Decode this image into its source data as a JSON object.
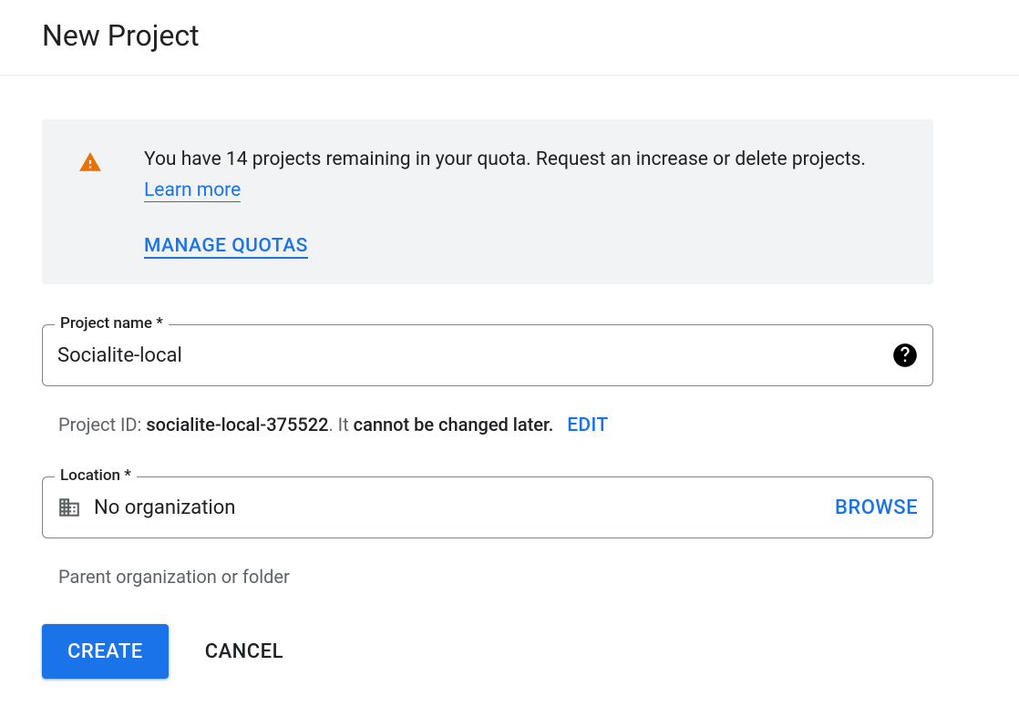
{
  "header": {
    "title": "New Project"
  },
  "quota_notice": {
    "message": "You have 14 projects remaining in your quota. Request an increase or delete projects. ",
    "learn_more_label": "Learn more",
    "manage_quotas_label": "MANAGE QUOTAS"
  },
  "form": {
    "project_name": {
      "label": "Project name *",
      "value": "Socialite-local"
    },
    "project_id": {
      "prefix": "Project ID: ",
      "id": "socialite-local-375522",
      "mid": ". It ",
      "emphasis": "cannot be changed later.",
      "edit_label": "EDIT"
    },
    "location": {
      "label": "Location *",
      "value": "No organization",
      "browse_label": "BROWSE",
      "helper": "Parent organization or folder"
    },
    "buttons": {
      "create": "CREATE",
      "cancel": "CANCEL"
    }
  }
}
